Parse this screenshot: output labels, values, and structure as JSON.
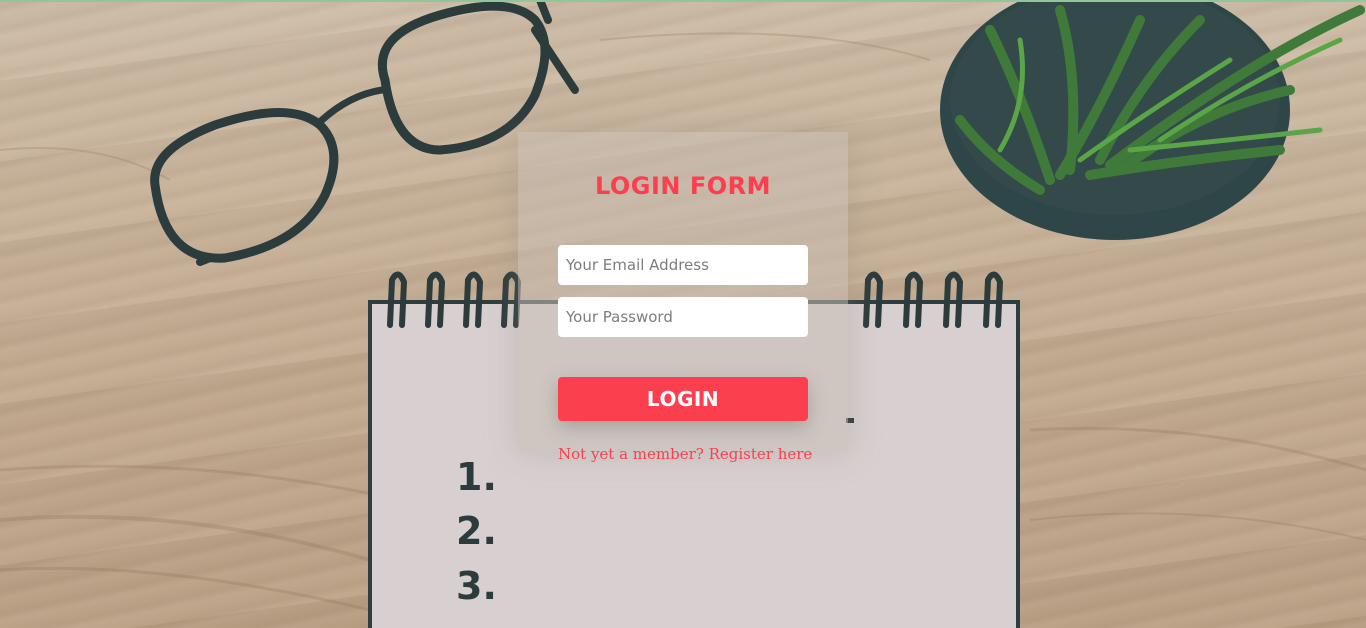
{
  "form": {
    "title": "LOGIN FORM",
    "email_placeholder": "Your Email Address",
    "password_placeholder": "Your Password",
    "login_label": "LOGIN",
    "register_link": "Not yet a member? Register here"
  },
  "background": {
    "notepad_items": [
      "1.",
      "2.",
      "3."
    ]
  },
  "colors": {
    "accent": "#fb3f4f",
    "input_bg": "#ffffff"
  }
}
